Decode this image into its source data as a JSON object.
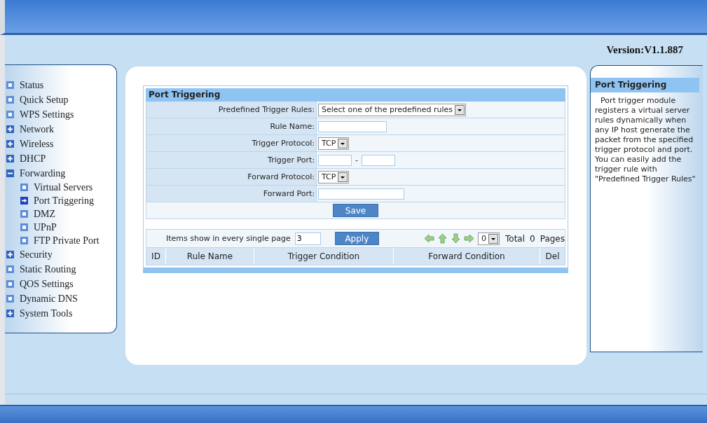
{
  "version": "Version:V1.1.887",
  "sidebar": {
    "items": [
      {
        "label": "Status",
        "kind": "page",
        "selected": false
      },
      {
        "label": "Quick Setup",
        "kind": "page",
        "selected": false
      },
      {
        "label": "WPS Settings",
        "kind": "page",
        "selected": false
      },
      {
        "label": "Network",
        "kind": "group",
        "expanded": false,
        "selected": false
      },
      {
        "label": "Wireless",
        "kind": "group",
        "expanded": false,
        "selected": false
      },
      {
        "label": "DHCP",
        "kind": "group",
        "expanded": false,
        "selected": false
      },
      {
        "label": "Forwarding",
        "kind": "group",
        "expanded": true,
        "selected": false,
        "children": [
          {
            "label": "Virtual Servers",
            "kind": "page",
            "selected": false
          },
          {
            "label": "Port Triggering",
            "kind": "page",
            "selected": true
          },
          {
            "label": "DMZ",
            "kind": "page",
            "selected": false
          },
          {
            "label": "UPnP",
            "kind": "page",
            "selected": false
          },
          {
            "label": "FTP Private Port",
            "kind": "page",
            "selected": false
          }
        ]
      },
      {
        "label": "Security",
        "kind": "group",
        "expanded": false,
        "selected": false
      },
      {
        "label": "Static Routing",
        "kind": "page",
        "selected": false
      },
      {
        "label": "QOS Settings",
        "kind": "page",
        "selected": false
      },
      {
        "label": "Dynamic DNS",
        "kind": "page",
        "selected": false
      },
      {
        "label": "System Tools",
        "kind": "group",
        "expanded": false,
        "selected": false
      }
    ]
  },
  "form": {
    "title": "Port Triggering",
    "rows": [
      {
        "label": "Predefined Trigger Rules:",
        "kind": "select",
        "value": "Select one of the predefined rules"
      },
      {
        "label": "Rule Name:",
        "kind": "text"
      },
      {
        "label": "Trigger Protocol:",
        "kind": "select",
        "value": "TCP"
      },
      {
        "label": "Trigger Port:",
        "kind": "range",
        "separator": "-"
      },
      {
        "label": "Forward Protocol:",
        "kind": "select",
        "value": "TCP"
      },
      {
        "label": "Forward Port:",
        "kind": "text",
        "wide": true
      }
    ],
    "save": "Save"
  },
  "pager": {
    "items_label": "Items show in every single page",
    "items_value": "3",
    "apply": "Apply",
    "page": "0",
    "total_label": "Total",
    "total": "0",
    "pages_label": "Pages"
  },
  "table": {
    "columns": [
      "ID",
      "Rule Name",
      "Trigger Condition",
      "Forward Condition",
      "Del"
    ]
  },
  "help": {
    "title": "Port Triggering",
    "text": "Port trigger module registers a virtual server rules dynamically when any IP host generate the packet from the specified trigger protocol and port. You can easily add the trigger rule with \"Predefined Trigger Rules\""
  }
}
